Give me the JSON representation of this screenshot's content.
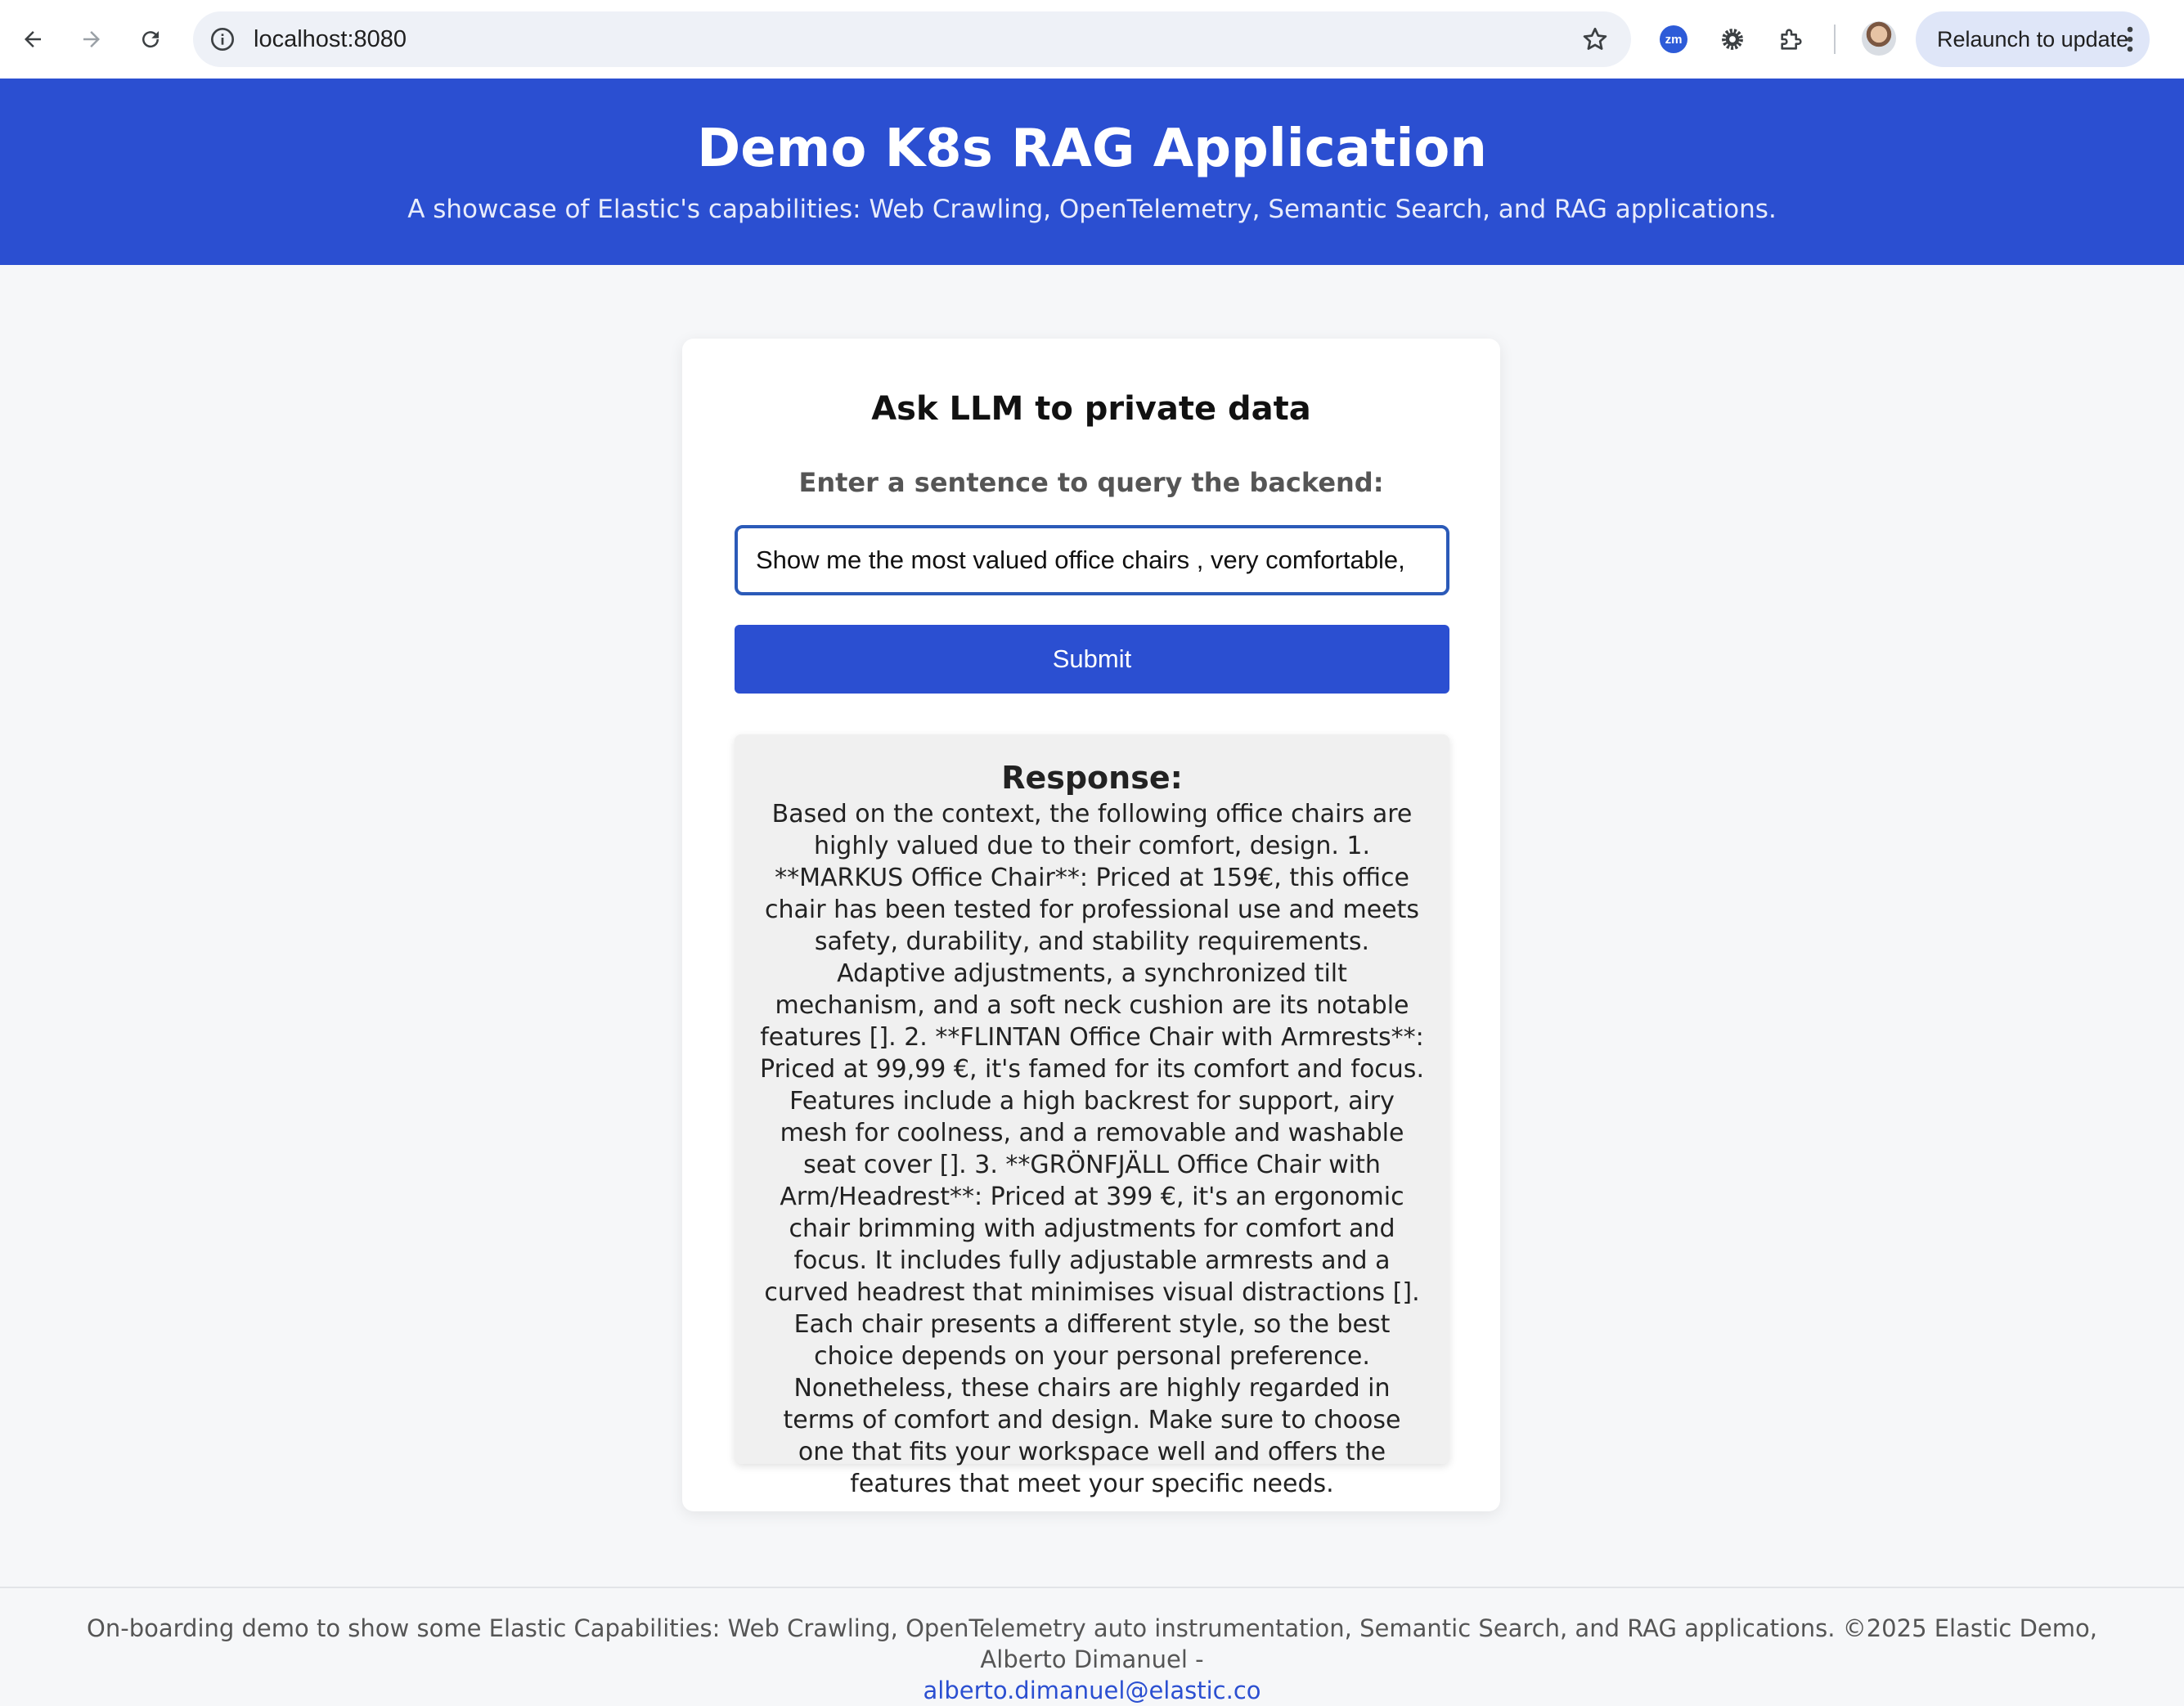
{
  "browser": {
    "url": "localhost:8080",
    "extension_badge": "zm",
    "relaunch_label": "Relaunch to update",
    "icons": [
      "back-arrow-icon",
      "forward-arrow-icon",
      "reload-icon",
      "info-icon",
      "star-icon",
      "zm-extension-icon",
      "gear-icon",
      "puzzle-extension-icon",
      "avatar",
      "kebab-menu-icon"
    ]
  },
  "header": {
    "title": "Demo K8s RAG Application",
    "subtitle": "A showcase of Elastic's capabilities: Web Crawling, OpenTelemetry, Semantic Search, and RAG applications."
  },
  "card": {
    "title": "Ask LLM to private data",
    "query_label": "Enter a sentence to query the backend:",
    "query_value": "Show me the most valued office chairs , very comfortable,",
    "submit_label": "Submit",
    "response_heading": "Response:",
    "response_text": "Based on the context, the following office chairs are highly valued due to their comfort, design. 1. **MARKUS Office Chair**: Priced at 159€, this office chair has been tested for professional use and meets safety, durability, and stability requirements. Adaptive adjustments, a synchronized tilt mechanism, and a soft neck cushion are its notable features []. 2. **FLINTAN Office Chair with Armrests**: Priced at 99,99 €, it's famed for its comfort and focus. Features include a high backrest for support, airy mesh for coolness, and a removable and washable seat cover []. 3. **GRÖNFJÄLL Office Chair with Arm/Headrest**: Priced at 399 €, it's an ergonomic chair brimming with adjustments for comfort and focus. It includes fully adjustable armrests and a curved headrest that minimises visual distractions []. Each chair presents a different style, so the best choice depends on your personal preference. Nonetheless, these chairs are highly regarded in terms of comfort and design. Make sure to choose one that fits your workspace well and offers the features that meet your specific needs."
  },
  "footer": {
    "text": "On-boarding demo to show some Elastic Capabilities: Web Crawling, OpenTelemetry auto instrumentation, Semantic Search, and RAG applications. ©2025 Elastic Demo, Alberto Dimanuel -",
    "email": "alberto.dimanuel@elastic.co"
  },
  "colors": {
    "brand_blue": "#2b4fd1",
    "input_border": "#2b5ab8",
    "page_background": "#f6f7f9",
    "response_background": "#f0f0f0"
  }
}
